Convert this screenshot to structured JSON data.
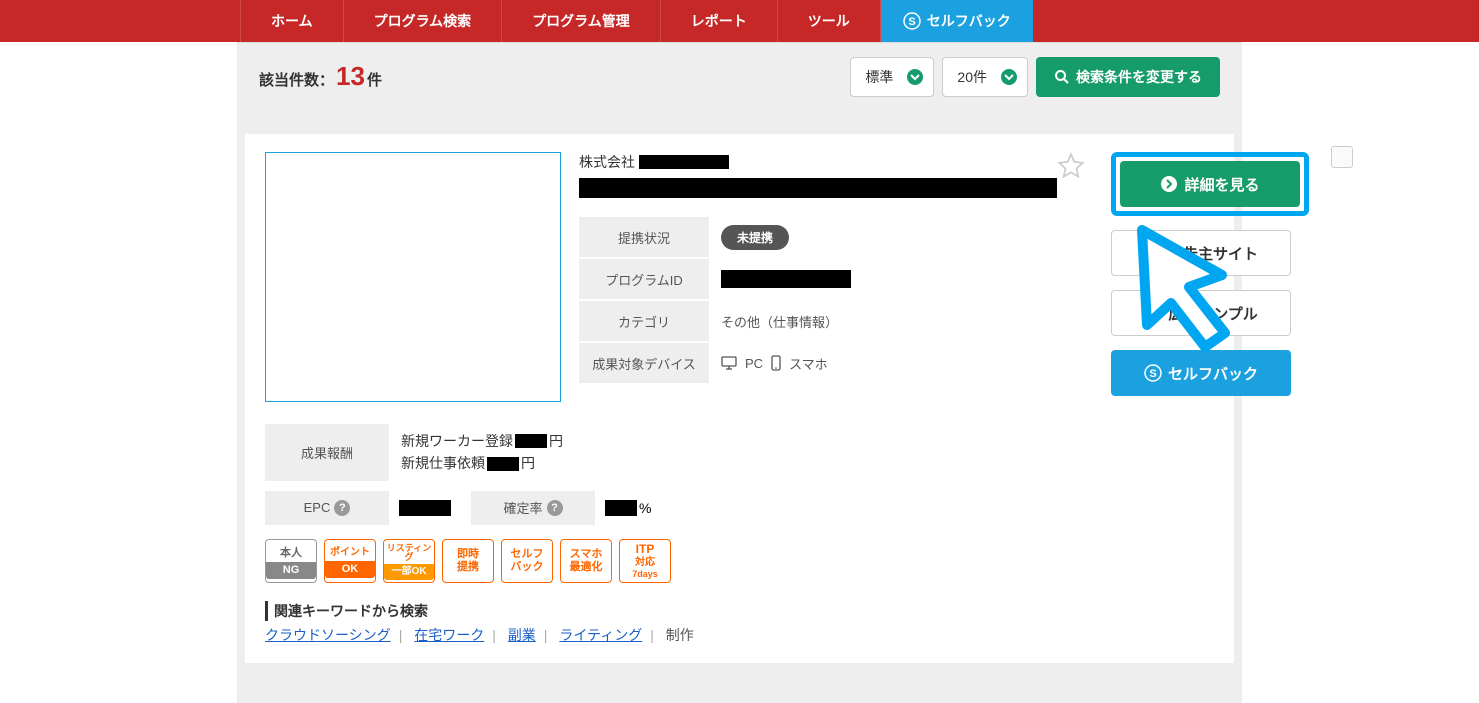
{
  "nav": {
    "home": "ホーム",
    "program_search": "プログラム検索",
    "program_manage": "プログラム管理",
    "report": "レポート",
    "tool": "ツール",
    "selfback": "セルフバック"
  },
  "subbar": {
    "count_label_pre": "該当件数：",
    "count": "13",
    "count_label_suf": "件",
    "sort": "標準",
    "per_page": "20件",
    "change_search": "検索条件を変更する"
  },
  "card": {
    "company_prefix": "株式会社",
    "details": {
      "status_label": "提携状況",
      "status_value": "未提携",
      "program_id_label": "プログラムID",
      "category_label": "カテゴリ",
      "category_value": "その他（仕事情報）",
      "device_label": "成果対象デバイス",
      "device_pc": "PC",
      "device_sp": "スマホ"
    },
    "actions": {
      "detail": "詳細を見る",
      "advertiser_site": "広告主サイト",
      "ad_sample": "広告サンプル",
      "selfback": "セルフバック"
    },
    "reward": {
      "label": "成果報酬",
      "line1_pre": "新規ワーカー登録",
      "line1_suf": "円",
      "line2_pre": "新規仕事依頼",
      "line2_suf": "円"
    },
    "metrics": {
      "epc_label": "EPC",
      "rate_label": "確定率",
      "rate_suf": "%"
    },
    "tags": {
      "t1_top": "本人",
      "t1_bot": "NG",
      "t2_top": "ポイント",
      "t2_bot": "OK",
      "t3_top": "リスティング",
      "t3_bot": "一部OK",
      "t4a": "即時",
      "t4b": "提携",
      "t5a": "セルフ",
      "t5b": "バック",
      "t6a": "スマホ",
      "t6b": "最適化",
      "t7a": "ITP",
      "t7b": "対応",
      "t7c": "7days"
    },
    "keywords": {
      "title": "関連キーワードから検索",
      "k1": "クラウドソーシング",
      "k2": "在宅ワーク",
      "k3": "副業",
      "k4": "ライティング",
      "k5": "制作"
    }
  }
}
